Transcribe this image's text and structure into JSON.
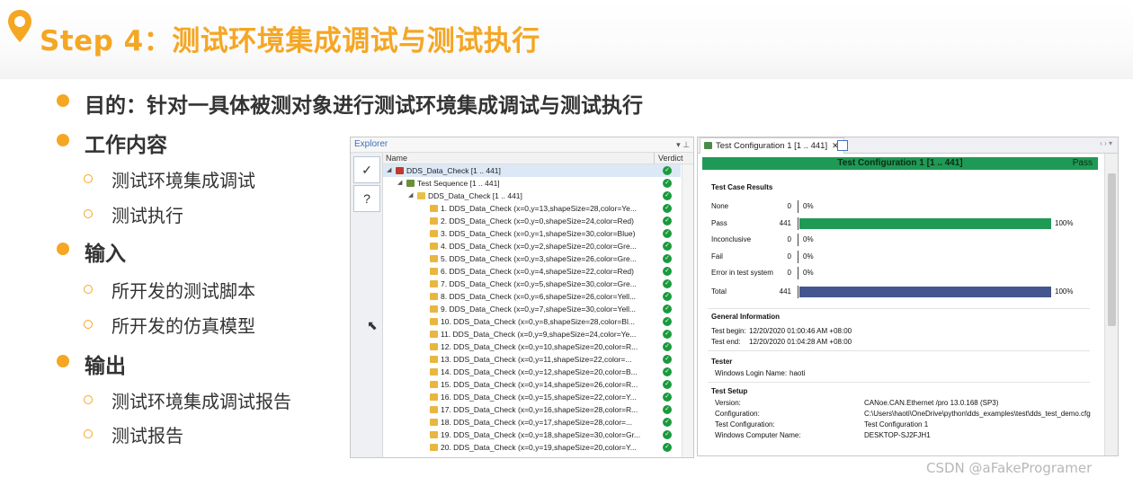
{
  "slide": {
    "title": "Step 4：测试环境集成调试与测试执行",
    "watermark": "CSDN @aFakeProgramer"
  },
  "bullets": {
    "purpose": "目的：针对一具体被测对象进行测试环境集成调试与测试执行",
    "work": "工作内容",
    "work_items": [
      "测试环境集成调试",
      "测试执行"
    ],
    "input": "输入",
    "input_items": [
      "所开发的测试脚本",
      "所开发的仿真模型"
    ],
    "output": "输出",
    "output_items": [
      "测试环境集成调试报告",
      "测试报告"
    ]
  },
  "explorer": {
    "title": "Explorer",
    "controls": "▾ ⊥",
    "col_name": "Name",
    "col_verdict": "Verdict",
    "root": "DDS_Data_Check [1 .. 441]",
    "sequence": "Test Sequence [1 .. 441]",
    "group": "DDS_Data_Check [1 .. 441]",
    "cases": [
      "1. DDS_Data_Check (x=0,y=13,shapeSize=28,color=Ye...",
      "2. DDS_Data_Check (x=0,y=0,shapeSize=24,color=Red)",
      "3. DDS_Data_Check (x=0,y=1,shapeSize=30,color=Blue)",
      "4. DDS_Data_Check (x=0,y=2,shapeSize=20,color=Gre...",
      "5. DDS_Data_Check (x=0,y=3,shapeSize=26,color=Gre...",
      "6. DDS_Data_Check (x=0,y=4,shapeSize=22,color=Red)",
      "7. DDS_Data_Check (x=0,y=5,shapeSize=30,color=Gre...",
      "8. DDS_Data_Check (x=0,y=6,shapeSize=26,color=Yell...",
      "9. DDS_Data_Check (x=0,y=7,shapeSize=30,color=Yell...",
      "10. DDS_Data_Check (x=0,y=8,shapeSize=28,color=Bl...",
      "11. DDS_Data_Check (x=0,y=9,shapeSize=24,color=Ye...",
      "12. DDS_Data_Check (x=0,y=10,shapeSize=20,color=R...",
      "13. DDS_Data_Check (x=0,y=11,shapeSize=22,color=...",
      "14. DDS_Data_Check (x=0,y=12,shapeSize=20,color=B...",
      "15. DDS_Data_Check (x=0,y=14,shapeSize=26,color=R...",
      "16. DDS_Data_Check (x=0,y=15,shapeSize=22,color=Y...",
      "17. DDS_Data_Check (x=0,y=16,shapeSize=28,color=R...",
      "18. DDS_Data_Check (x=0,y=17,shapeSize=28,color=...",
      "19. DDS_Data_Check (x=0,y=18,shapeSize=30,color=Gr...",
      "20. DDS_Data_Check (x=0,y=19,shapeSize=20,color=Y..."
    ]
  },
  "report": {
    "tab_label": "Test Configuration 1 [1 .. 441]",
    "tab_close": "✕",
    "banner_title": "Test Configuration 1 [1 .. 441]",
    "banner_verdict": "Pass",
    "results_heading": "Test Case Results",
    "results": [
      {
        "label": "None",
        "count": "0",
        "pct": "0%",
        "fraction": 0,
        "color": "#1e9a56"
      },
      {
        "label": "Pass",
        "count": "441",
        "pct": "100%",
        "fraction": 1,
        "color": "#1e9a56"
      },
      {
        "label": "Inconclusive",
        "count": "0",
        "pct": "0%",
        "fraction": 0,
        "color": "#1e9a56"
      },
      {
        "label": "Fail",
        "count": "0",
        "pct": "0%",
        "fraction": 0,
        "color": "#1e9a56"
      },
      {
        "label": "Error in test system",
        "count": "0",
        "pct": "0%",
        "fraction": 0,
        "color": "#1e9a56"
      },
      {
        "label": "Total",
        "count": "441",
        "pct": "100%",
        "fraction": 1,
        "color": "#44558f"
      }
    ],
    "general_heading": "General Information",
    "begin_label": "Test begin:",
    "begin_value": "12/20/2020 01:00:46 AM +08:00",
    "end_label": "Test end:",
    "end_value": "12/20/2020 01:04:28 AM +08:00",
    "tester_heading": "Tester",
    "login_label": "Windows Login Name:",
    "login_value": "haoti",
    "setup_heading": "Test Setup",
    "setup": [
      {
        "k": "Version:",
        "v": "CANoe.CAN.Ethernet /pro 13.0.168 (SP3)"
      },
      {
        "k": "Configuration:",
        "v": "C:\\Users\\haoti\\OneDrive\\python\\dds_examples\\test\\dds_test_demo.cfg"
      },
      {
        "k": "Test Configuration:",
        "v": "Test Configuration 1"
      },
      {
        "k": "Windows Computer Name:",
        "v": "DESKTOP-SJ2FJH1"
      }
    ]
  }
}
